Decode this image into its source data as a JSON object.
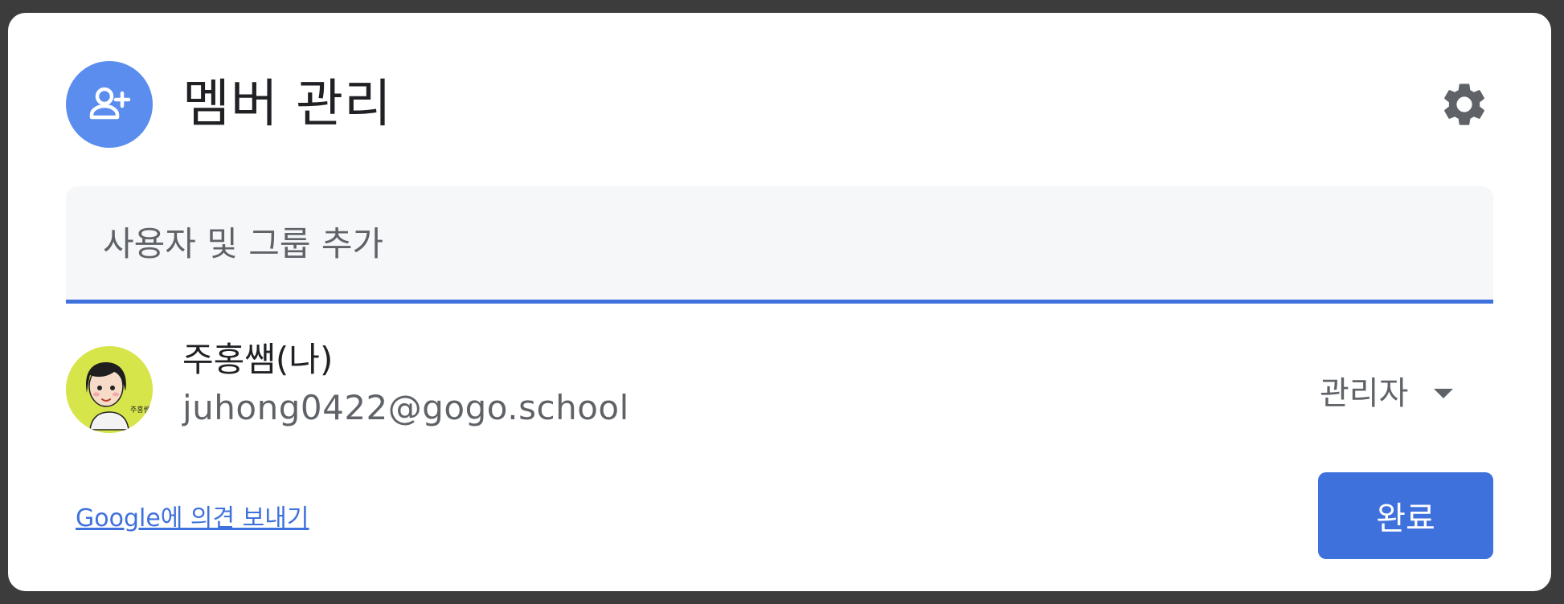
{
  "dialog": {
    "title": "멤버 관리",
    "header_icon": "add-person-icon",
    "settings_icon": "gear-icon"
  },
  "search": {
    "placeholder": "사용자 및 그룹 추가",
    "value": ""
  },
  "members": [
    {
      "name": "주홍쌤(나)",
      "email": "juhong0422@gogo.school",
      "role": "관리자",
      "avatar_caption": "주홍쌤"
    }
  ],
  "footer": {
    "feedback_link": "Google에 의견 보내기",
    "done_button": "완료"
  },
  "colors": {
    "accent": "#3f71dc",
    "header_icon_bg": "#5b8def",
    "avatar_bg": "#d6e64a"
  }
}
